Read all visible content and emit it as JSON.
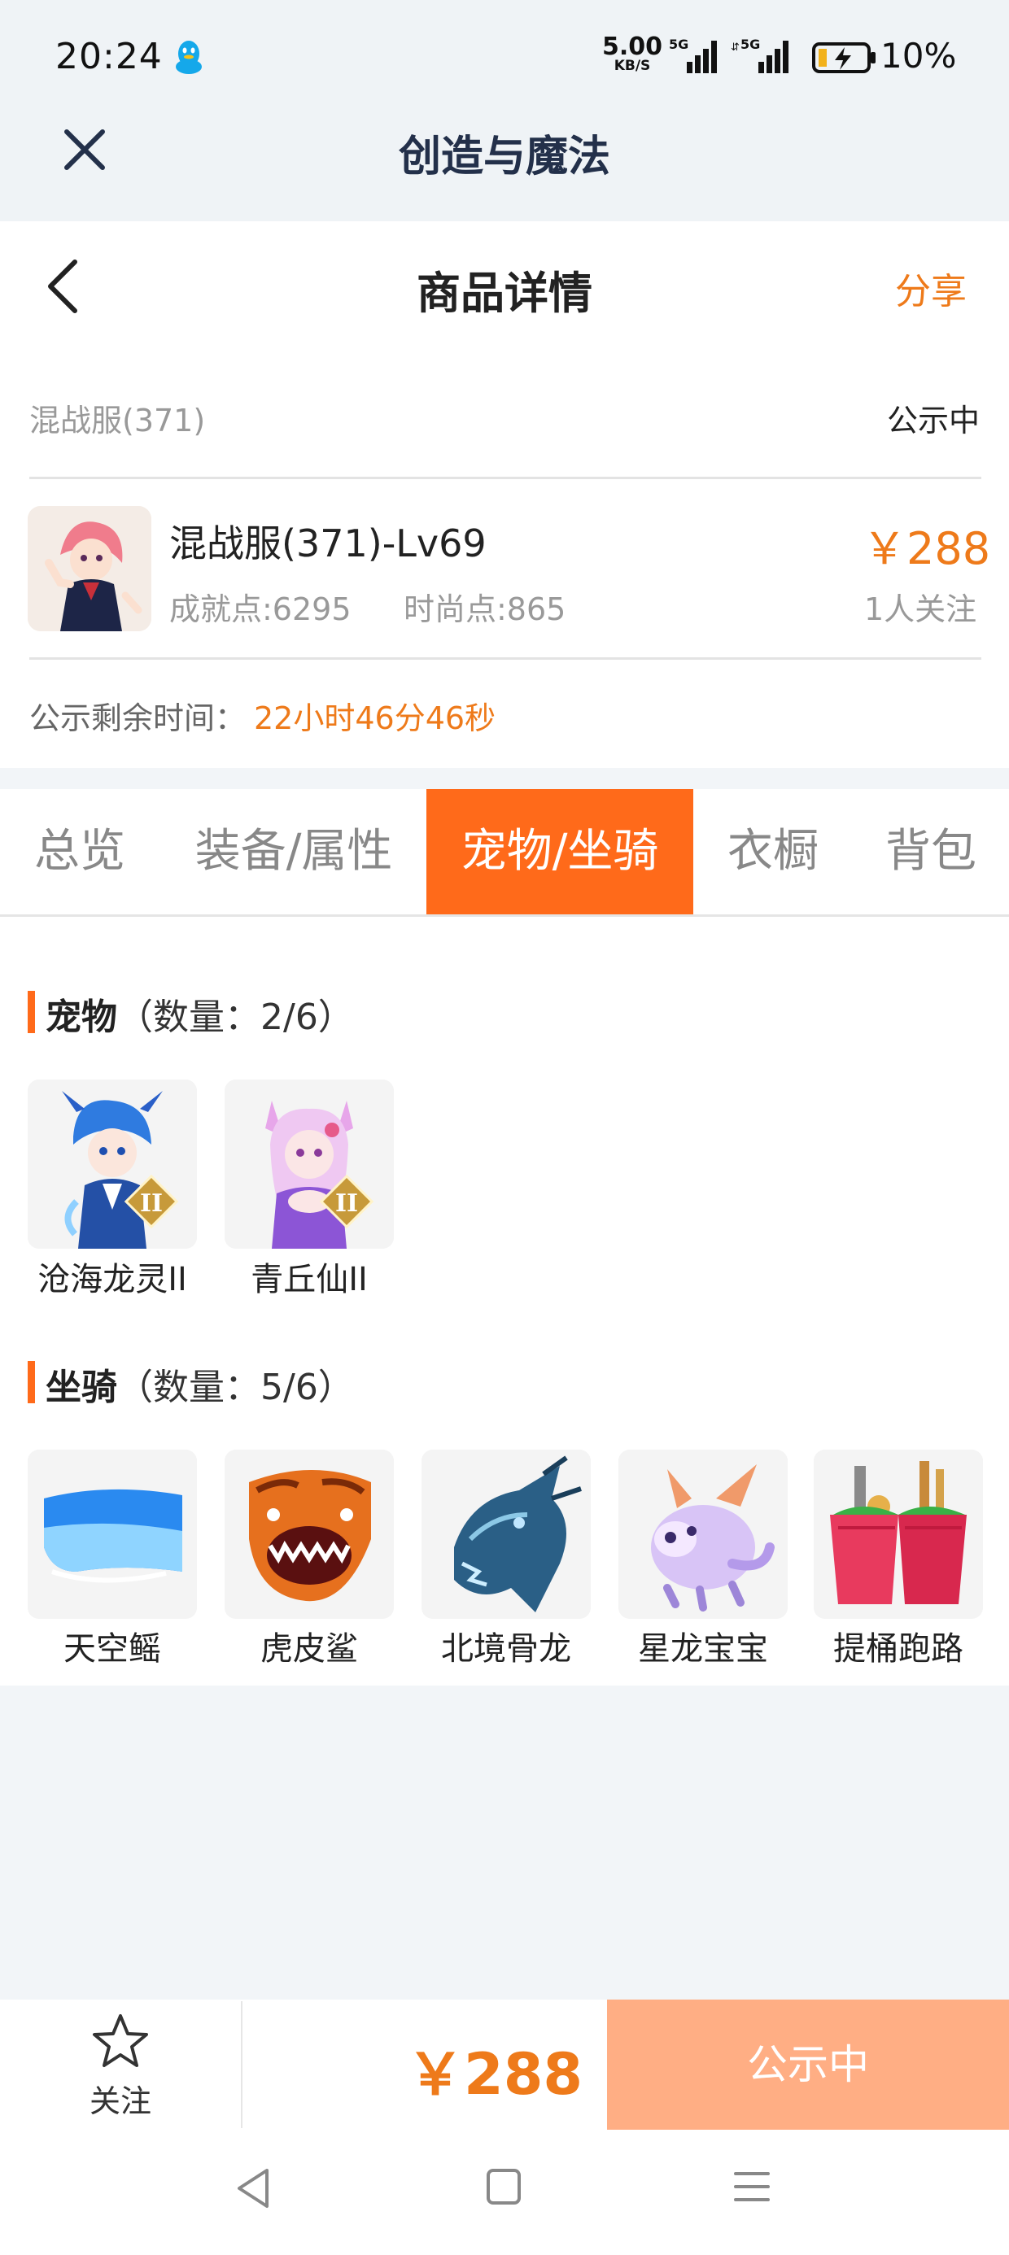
{
  "status_bar": {
    "time": "20:24",
    "net_speed": "5.00",
    "net_unit": "KB/S",
    "signal1_label": "5G",
    "signal2_label": "5G",
    "battery": "10%"
  },
  "app_header": {
    "title": "创造与魔法",
    "close_icon": "close-icon"
  },
  "page_header": {
    "title": "商品详情",
    "share": "分享",
    "back_icon": "chevron-left-icon"
  },
  "listing": {
    "server": "混战服(371)",
    "status": "公示中",
    "name": "混战服(371)-Lv69",
    "achievement": "成就点:6295",
    "fashion": "时尚点:865",
    "price": "￥288",
    "followers": "1人关注",
    "remaining_label": "公示剩余时间：",
    "remaining_value": "22小时46分46秒"
  },
  "tabs": [
    {
      "label": "总览"
    },
    {
      "label": "装备/属性"
    },
    {
      "label": "宠物/坐骑",
      "active": true
    },
    {
      "label": "衣橱"
    },
    {
      "label": "背包"
    }
  ],
  "pets": {
    "title": "宠物",
    "count": "（数量：2/6）",
    "items": [
      {
        "name": "沧海龙灵II",
        "icon": "blue-dragon-spirit-icon"
      },
      {
        "name": "青丘仙II",
        "icon": "fox-fairy-icon"
      }
    ]
  },
  "mounts": {
    "title": "坐骑",
    "count": "（数量：5/6）",
    "items": [
      {
        "name": "天空鳐",
        "icon": "sky-ray-icon"
      },
      {
        "name": "虎皮鲨",
        "icon": "tiger-shark-icon"
      },
      {
        "name": "北境骨龙",
        "icon": "bone-dragon-icon"
      },
      {
        "name": "星龙宝宝",
        "icon": "star-dragon-baby-icon"
      },
      {
        "name": "提桶跑路",
        "icon": "bucket-icon"
      }
    ]
  },
  "bottom_bar": {
    "follow": "关注",
    "price": "￥288",
    "action": "公示中"
  },
  "colors": {
    "accent": "#ff6a1a",
    "price": "#ee7a1a",
    "disabled_button": "#ffae84"
  }
}
